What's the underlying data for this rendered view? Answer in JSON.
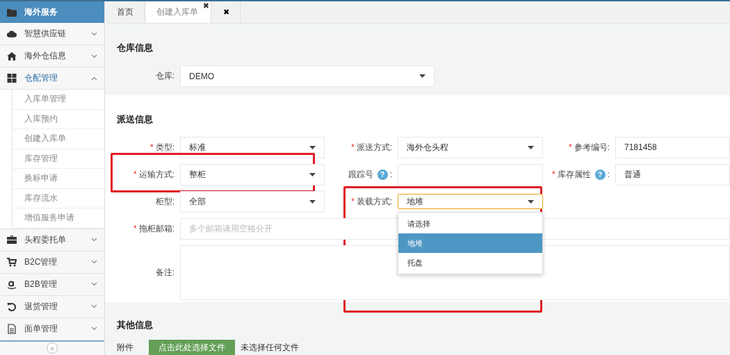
{
  "sidebar": {
    "header": "海外服务",
    "items": [
      {
        "label": "智慧供应链",
        "expanded": false
      },
      {
        "label": "海外仓信息",
        "expanded": false
      },
      {
        "label": "仓配管理",
        "expanded": true,
        "children": [
          {
            "label": "入库单管理"
          },
          {
            "label": "入库预约"
          },
          {
            "label": "创建入库单"
          },
          {
            "label": "库存管理"
          },
          {
            "label": "换标申请"
          },
          {
            "label": "库存流水"
          },
          {
            "label": "增值服务申请"
          }
        ]
      },
      {
        "label": "头程委托单",
        "expanded": false
      },
      {
        "label": "B2C管理",
        "expanded": false
      },
      {
        "label": "B2B管理",
        "expanded": false
      },
      {
        "label": "退货管理",
        "expanded": false
      },
      {
        "label": "面单管理",
        "expanded": false
      }
    ],
    "collapse": "«"
  },
  "tabs": [
    {
      "label": "首页",
      "selected": false
    },
    {
      "label": "创建入库单",
      "selected": true,
      "close": "✖"
    }
  ],
  "close_all": "✖",
  "warehouse_section": {
    "title": "仓库信息",
    "field": {
      "label": "仓库:",
      "value": "DEMO",
      "kind": "select"
    }
  },
  "dispatch_section": {
    "title": "派送信息",
    "rows": [
      [
        {
          "mark": "*",
          "label": "类型:",
          "kind": "select",
          "value": "标准"
        },
        {
          "mark": "*",
          "label": "派送方式:",
          "kind": "select",
          "value": "海外仓头程"
        },
        {
          "mark": "*",
          "label": "参考编号:",
          "kind": "text",
          "value": "7181458"
        }
      ],
      [
        {
          "mark": "*",
          "label": "运输方式:",
          "kind": "select",
          "value": "整柜",
          "highlighted": true
        },
        {
          "label": "跟踪号",
          "help": "?",
          "suffix": ":",
          "kind": "text"
        },
        {
          "mark": "*",
          "label": "库存属性",
          "help": "?",
          "suffix": ":",
          "kind": "text",
          "value": "普通"
        }
      ],
      [
        {
          "label": "柜型:",
          "kind": "select",
          "value": "全部"
        },
        {
          "mark": "*",
          "label": "装载方式:",
          "kind": "select",
          "value": "地堆",
          "focused": true,
          "highlighted": true
        }
      ],
      [
        {
          "mark": "*",
          "label": "拖柜邮箱:",
          "kind": "text",
          "placeholder": "多个邮箱请用空格分开"
        }
      ],
      [
        {
          "label": "备注:",
          "kind": "textarea"
        }
      ]
    ],
    "open_dropdown": {
      "options": [
        {
          "label": "请选择",
          "selected": false
        },
        {
          "label": "地堆",
          "selected": true
        },
        {
          "label": "托盘",
          "selected": false
        }
      ]
    }
  },
  "other_section": {
    "title": "其他信息",
    "attachment": {
      "label": "附件",
      "button": "点击此处选择文件",
      "status": "未选择任何文件"
    }
  }
}
